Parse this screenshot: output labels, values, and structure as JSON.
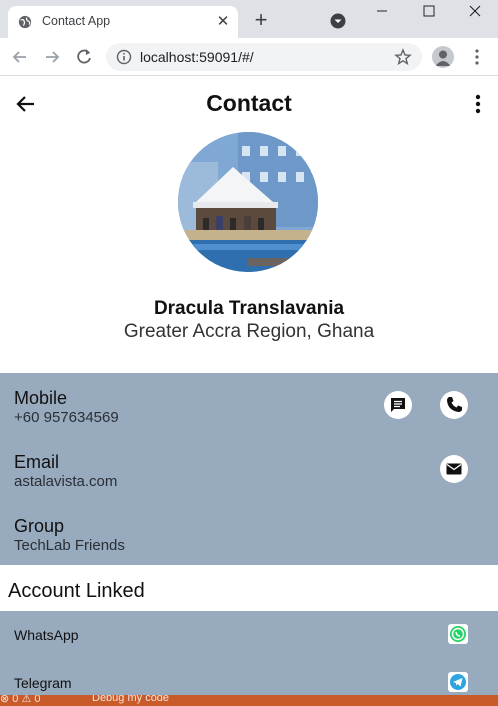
{
  "browser": {
    "tab_title": "Contact App",
    "new_tab_symbol": "+",
    "close_symbol": "✕",
    "url": "localhost:59091/#/"
  },
  "app": {
    "title": "Contact"
  },
  "contact": {
    "name": "Dracula Translavania",
    "location": "Greater Accra Region, Ghana",
    "details": [
      {
        "title": "Mobile",
        "value": "+60 957634569"
      },
      {
        "title": "Email",
        "value": "astalavista.com"
      },
      {
        "title": "Group",
        "value": "TechLab Friends"
      }
    ]
  },
  "accounts": {
    "heading": "Account Linked",
    "items": [
      {
        "label": "WhatsApp",
        "icon": "whatsapp-icon",
        "color": "#25d366"
      },
      {
        "label": "Telegram",
        "icon": "telegram-icon",
        "color": "#2ca5e0"
      }
    ]
  },
  "statusbar": {
    "counts": "⊗ 0 ⚠ 0",
    "debug_label": "Debug my code",
    "color": "#c95b2a"
  },
  "colors": {
    "panel": "#98aabd",
    "chrome": "#dee1e6"
  }
}
